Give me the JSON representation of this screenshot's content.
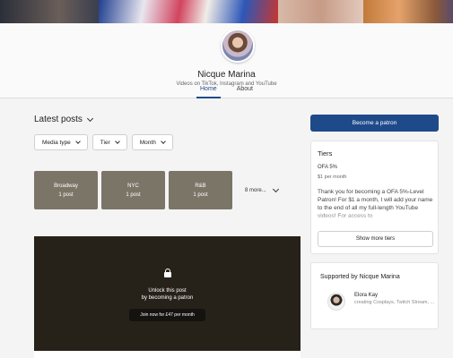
{
  "creator": {
    "name": "Nicque Marina",
    "tagline": "Videos on TikTok, Instagram and YouTube"
  },
  "tabs": [
    {
      "label": "Home",
      "active": true
    },
    {
      "label": "About",
      "active": false
    }
  ],
  "posts": {
    "section_title": "Latest posts",
    "filters": [
      {
        "label": "Media type"
      },
      {
        "label": "Tier"
      },
      {
        "label": "Month"
      }
    ],
    "collections": [
      {
        "name": "Broadway",
        "count": "1 post"
      },
      {
        "name": "NYC",
        "count": "1 post"
      },
      {
        "name": "R&B",
        "count": "1 post"
      }
    ],
    "more_collections": "8 more...",
    "locked": {
      "line1": "Unlock this post",
      "line2": "by becoming a patron",
      "join_label": "Join now for £47 per month"
    }
  },
  "sidebar": {
    "become_patron": "Become a patron",
    "tiers": {
      "title": "Tiers",
      "tier_name": "OFA 5%",
      "tier_price": "$1 per month",
      "tier_desc": "Thank you for becoming a OFA 5%-Level Patron! For $1 a month, I will add your name to the end of all my full-length YouTube videos! For access to",
      "show_more": "Show more tiers"
    },
    "supported": {
      "title": "Supported by Nicque Marina",
      "supporter_name": "Elora Kay",
      "supporter_desc": "creating Cosplays, Twitch Stream, ..."
    }
  },
  "colors": {
    "accent": "#1f4a8a",
    "locked_bg": "#262219",
    "collection_bg": "#7b7568"
  }
}
